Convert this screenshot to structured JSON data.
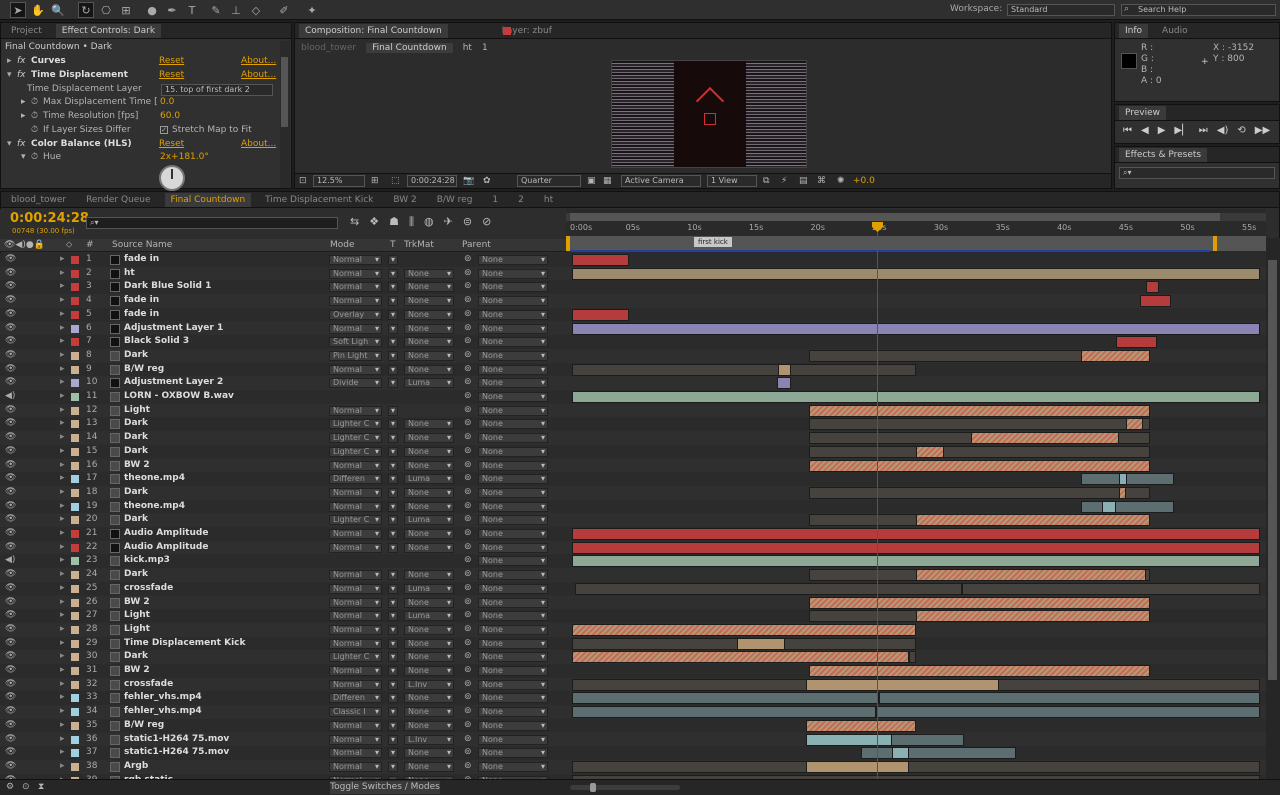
{
  "toolbar": {
    "workspace_label": "Workspace:",
    "workspace_value": "Standard",
    "search_placeholder": "Search Help"
  },
  "project_tabs": {
    "project": "Project",
    "effect_controls": "Effect Controls: Dark"
  },
  "effect_controls": {
    "layer_title": "Final Countdown • Dark",
    "rows": [
      {
        "name": "Curves",
        "reset": "Reset",
        "about": "About..."
      },
      {
        "name": "Time Displacement",
        "reset": "Reset",
        "about": "About..."
      },
      {
        "name": "Time Displacement Layer",
        "value": "15. top of first dark 2"
      },
      {
        "name": "Max Displacement Time [sec]",
        "value": "0.0"
      },
      {
        "name": "Time Resolution [fps]",
        "value": "60.0"
      },
      {
        "name": "If Layer Sizes Differ",
        "value": "Stretch Map to Fit"
      },
      {
        "name": "Color Balance (HLS)",
        "reset": "Reset",
        "about": "About..."
      },
      {
        "name": "Hue",
        "value": "2x+181.0°"
      }
    ]
  },
  "composition": {
    "tab": "Composition: Final Countdown",
    "layer_tab": "Layer: zbuf",
    "crumbs": [
      "blood_tower",
      "Final Countdown",
      "ht",
      "1"
    ],
    "zoom": "12.5%",
    "timecode": "0:00:24:28",
    "resolution": "Quarter",
    "camera": "Active Camera",
    "view": "1 View",
    "exposure": "+0.0"
  },
  "info": {
    "tab": "Info",
    "audio_tab": "Audio",
    "r": "R :",
    "g": "G :",
    "b": "B :",
    "a": "A : 0",
    "x": "X : -3152",
    "y": "Y : 800"
  },
  "preview": {
    "tab": "Preview"
  },
  "effects_presets": {
    "tab": "Effects & Presets"
  },
  "timeline_tabs": [
    "blood_tower",
    "Render Queue",
    "Final Countdown",
    "Time Displacement Kick",
    "BW 2",
    "B/W reg",
    "1",
    "2",
    "ht"
  ],
  "timeline": {
    "timecode": "0:00:24:28",
    "frame_info": "00748 (30.00 fps)",
    "col_source": "Source Name",
    "col_mode": "Mode",
    "col_t": "T",
    "col_trkmat": "TrkMat",
    "col_parent": "Parent",
    "marker": "first kick",
    "toggle_label": "Toggle Switches / Modes",
    "ruler": [
      "0:00s",
      "05s",
      "10s",
      "15s",
      "20s",
      "25s",
      "30s",
      "35s",
      "40s",
      "45s",
      "50s",
      "55s"
    ],
    "layers": [
      {
        "num": "1",
        "name": "fade in",
        "color": "#c43c3c",
        "mode": "Normal",
        "trk": "",
        "parent": "None",
        "bars": [
          [
            0,
            0.083,
            "#b43c3c",
            0
          ]
        ]
      },
      {
        "num": "2",
        "name": "ht",
        "color": "#c43c3c",
        "mode": "Normal",
        "trk": "None",
        "parent": "None",
        "bars": [
          [
            0,
            1,
            "#9c8a6c",
            0
          ]
        ]
      },
      {
        "num": "3",
        "name": "Dark Blue Solid 1",
        "color": "#c43c3c",
        "mode": "Normal",
        "trk": "None",
        "parent": "None",
        "bars": [
          [
            0.835,
            0.853,
            "#b43c3c",
            0
          ]
        ]
      },
      {
        "num": "4",
        "name": "fade in",
        "color": "#c43c3c",
        "mode": "Normal",
        "trk": "None",
        "parent": "None",
        "bars": [
          [
            0.825,
            0.87,
            "#b43c3c",
            0
          ]
        ]
      },
      {
        "num": "5",
        "name": "fade in",
        "color": "#c43c3c",
        "mode": "Overlay",
        "trk": "None",
        "parent": "None",
        "bars": [
          [
            0,
            0.083,
            "#b43c3c",
            0
          ]
        ]
      },
      {
        "num": "6",
        "name": "Adjustment Layer 1",
        "color": "#a8a8d0",
        "mode": "Normal",
        "trk": "None",
        "parent": "None",
        "bars": [
          [
            0,
            1,
            "#8a84b4",
            0
          ]
        ]
      },
      {
        "num": "7",
        "name": "Black Solid 3",
        "color": "#c43c3c",
        "mode": "Soft Ligh",
        "trk": "None",
        "parent": "None",
        "bars": [
          [
            0.79,
            0.85,
            "#b43c3c",
            0
          ]
        ]
      },
      {
        "num": "8",
        "name": "Dark",
        "color": "#c8b090",
        "mode": "Pin Light",
        "trk": "None",
        "parent": "None",
        "bars": [
          [
            0.345,
            0.84,
            "#46433e",
            0
          ],
          [
            0.74,
            0.84,
            "",
            1
          ]
        ]
      },
      {
        "num": "9",
        "name": "B/W reg",
        "color": "#c8b090",
        "mode": "Normal",
        "trk": "None",
        "parent": "None",
        "bars": [
          [
            0,
            0.5,
            "#46433e",
            0
          ],
          [
            0.3,
            0.318,
            "#b09470",
            0
          ]
        ]
      },
      {
        "num": "10",
        "name": "Adjustment Layer 2",
        "color": "#a8a8d0",
        "mode": "Divide",
        "trk": "Luma",
        "parent": "None",
        "bars": [
          [
            0.298,
            0.318,
            "#8a84b4",
            0
          ]
        ]
      },
      {
        "num": "11",
        "name": "LORN - OXBOW B.wav",
        "color": "#9cc0a8",
        "mode": "",
        "trk": "",
        "parent": "None",
        "bars": [
          [
            0,
            1,
            "#8ea896",
            0
          ]
        ]
      },
      {
        "num": "12",
        "name": "Light",
        "color": "#c8b090",
        "mode": "Normal",
        "trk": "",
        "parent": "None",
        "bars": [
          [
            0.345,
            0.84,
            "",
            1
          ]
        ]
      },
      {
        "num": "13",
        "name": "Dark",
        "color": "#c8b090",
        "mode": "Lighter C",
        "trk": "None",
        "parent": "None",
        "bars": [
          [
            0.345,
            0.84,
            "#46433e",
            0
          ],
          [
            0.805,
            0.83,
            "",
            1
          ]
        ]
      },
      {
        "num": "14",
        "name": "Dark",
        "color": "#c8b090",
        "mode": "Lighter C",
        "trk": "None",
        "parent": "None",
        "bars": [
          [
            0.345,
            0.84,
            "#46433e",
            0
          ],
          [
            0.58,
            0.795,
            "",
            1
          ]
        ]
      },
      {
        "num": "15",
        "name": "Dark",
        "color": "#c8b090",
        "mode": "Lighter C",
        "trk": "None",
        "parent": "None",
        "bars": [
          [
            0.345,
            0.84,
            "#46433e",
            0
          ],
          [
            0.5,
            0.54,
            "",
            1
          ]
        ]
      },
      {
        "num": "16",
        "name": "BW 2",
        "color": "#c8b090",
        "mode": "Normal",
        "trk": "None",
        "parent": "None",
        "bars": [
          [
            0.345,
            0.84,
            "",
            1
          ]
        ]
      },
      {
        "num": "17",
        "name": "theone.mp4",
        "color": "#a0d0e0",
        "mode": "Differen",
        "trk": "Luma",
        "parent": "None",
        "bars": [
          [
            0.74,
            0.875,
            "#5c6e70",
            0
          ],
          [
            0.795,
            0.807,
            "#8ab0b4",
            0
          ]
        ]
      },
      {
        "num": "18",
        "name": "Dark",
        "color": "#c8b090",
        "mode": "Normal",
        "trk": "None",
        "parent": "None",
        "bars": [
          [
            0.345,
            0.84,
            "#46433e",
            0
          ],
          [
            0.795,
            0.805,
            "",
            1
          ]
        ]
      },
      {
        "num": "19",
        "name": "theone.mp4",
        "color": "#a0d0e0",
        "mode": "Normal",
        "trk": "None",
        "parent": "None",
        "bars": [
          [
            0.74,
            0.875,
            "#5c6e70",
            0
          ],
          [
            0.77,
            0.79,
            "#8ab0b4",
            0
          ]
        ]
      },
      {
        "num": "20",
        "name": "Dark",
        "color": "#c8b090",
        "mode": "Lighter C",
        "trk": "Luma",
        "parent": "None",
        "bars": [
          [
            0.345,
            0.84,
            "#46433e",
            0
          ],
          [
            0.5,
            0.84,
            "",
            1
          ]
        ]
      },
      {
        "num": "21",
        "name": "Audio Amplitude",
        "color": "#c43c3c",
        "mode": "Normal",
        "trk": "None",
        "parent": "None",
        "bars": [
          [
            0,
            1,
            "#b43c3c",
            0
          ]
        ]
      },
      {
        "num": "22",
        "name": "Audio Amplitude",
        "color": "#c43c3c",
        "mode": "Normal",
        "trk": "None",
        "parent": "None",
        "bars": [
          [
            0,
            1,
            "#b43c3c",
            0
          ]
        ]
      },
      {
        "num": "23",
        "name": "kick.mp3",
        "color": "#9cc0a8",
        "mode": "",
        "trk": "",
        "parent": "None",
        "bars": [
          [
            0,
            1,
            "#8ea896",
            0
          ]
        ]
      },
      {
        "num": "24",
        "name": "Dark",
        "color": "#c8b090",
        "mode": "Normal",
        "trk": "None",
        "parent": "None",
        "bars": [
          [
            0.345,
            0.84,
            "#46433e",
            0
          ],
          [
            0.5,
            0.835,
            "",
            1
          ]
        ]
      },
      {
        "num": "25",
        "name": "crossfade",
        "color": "#c8b090",
        "mode": "Normal",
        "trk": "Luma",
        "parent": "None",
        "bars": [
          [
            0.005,
            1,
            "#46433e",
            0
          ],
          [
            0.565,
            0.568,
            "#b09470",
            0
          ]
        ]
      },
      {
        "num": "26",
        "name": "BW 2",
        "color": "#c8b090",
        "mode": "Normal",
        "trk": "None",
        "parent": "None",
        "bars": [
          [
            0.345,
            0.84,
            "",
            1
          ]
        ]
      },
      {
        "num": "27",
        "name": "Light",
        "color": "#c8b090",
        "mode": "Normal",
        "trk": "Luma",
        "parent": "None",
        "bars": [
          [
            0.345,
            0.84,
            "#46433e",
            0
          ],
          [
            0.5,
            0.84,
            "",
            1
          ]
        ]
      },
      {
        "num": "28",
        "name": "Light",
        "color": "#c8b090",
        "mode": "Normal",
        "trk": "None",
        "parent": "None",
        "bars": [
          [
            0,
            0.5,
            "",
            1
          ]
        ]
      },
      {
        "num": "29",
        "name": "Time Displacement Kick",
        "color": "#c8b090",
        "mode": "Normal",
        "trk": "None",
        "parent": "None",
        "bars": [
          [
            0,
            0.5,
            "#46433e",
            0
          ],
          [
            0.24,
            0.31,
            "#b09470",
            0
          ]
        ]
      },
      {
        "num": "30",
        "name": "Dark",
        "color": "#c8b090",
        "mode": "Lighter C",
        "trk": "None",
        "parent": "None",
        "bars": [
          [
            0,
            0.49,
            "",
            1
          ],
          [
            0.49,
            0.5,
            "#46433e",
            0
          ]
        ]
      },
      {
        "num": "31",
        "name": "BW 2",
        "color": "#c8b090",
        "mode": "Normal",
        "trk": "None",
        "parent": "None",
        "bars": [
          [
            0.345,
            0.84,
            "",
            1
          ]
        ]
      },
      {
        "num": "32",
        "name": "crossfade",
        "color": "#c8b090",
        "mode": "Normal",
        "trk": "L.Inv",
        "parent": "None",
        "bars": [
          [
            0,
            1,
            "#46433e",
            0
          ],
          [
            0.34,
            0.62,
            "#b09470",
            0
          ]
        ]
      },
      {
        "num": "33",
        "name": "fehler_vhs.mp4",
        "color": "#a0d0e0",
        "mode": "Differen",
        "trk": "None",
        "parent": "None",
        "bars": [
          [
            0,
            1,
            "#5c6e70",
            0
          ],
          [
            0.445,
            0.448,
            "#8ab0b4",
            0
          ]
        ]
      },
      {
        "num": "34",
        "name": "fehler_vhs.mp4",
        "color": "#a0d0e0",
        "mode": "Classic I",
        "trk": "None",
        "parent": "None",
        "bars": [
          [
            0,
            1,
            "#5c6e70",
            0
          ],
          [
            0.44,
            0.442,
            "#8ab0b4",
            0
          ]
        ]
      },
      {
        "num": "35",
        "name": "B/W reg",
        "color": "#c8b090",
        "mode": "Normal",
        "trk": "None",
        "parent": "None",
        "bars": [
          [
            0.34,
            0.5,
            "",
            1
          ]
        ]
      },
      {
        "num": "36",
        "name": "static1-H264 75.mov",
        "color": "#a0d0e0",
        "mode": "Normal",
        "trk": "L.Inv",
        "parent": "None",
        "bars": [
          [
            0.34,
            0.57,
            "#5c6e70",
            0
          ],
          [
            0.34,
            0.465,
            "#8ab0b4",
            0
          ]
        ]
      },
      {
        "num": "37",
        "name": "static1-H264 75.mov",
        "color": "#a0d0e0",
        "mode": "Normal",
        "trk": "None",
        "parent": "None",
        "bars": [
          [
            0.42,
            0.645,
            "#5c6e70",
            0
          ],
          [
            0.465,
            0.49,
            "#8ab0b4",
            0
          ]
        ]
      },
      {
        "num": "38",
        "name": "Argb",
        "color": "#c8b090",
        "mode": "Normal",
        "trk": "None",
        "parent": "None",
        "bars": [
          [
            0,
            1,
            "#46433e",
            0
          ],
          [
            0.34,
            0.49,
            "#b09470",
            0
          ]
        ]
      },
      {
        "num": "39",
        "name": "rgb static",
        "color": "#c8b090",
        "mode": "Normal",
        "trk": "None",
        "parent": "None",
        "bars": [
          [
            0,
            1,
            "#46433e",
            0
          ]
        ]
      }
    ]
  }
}
